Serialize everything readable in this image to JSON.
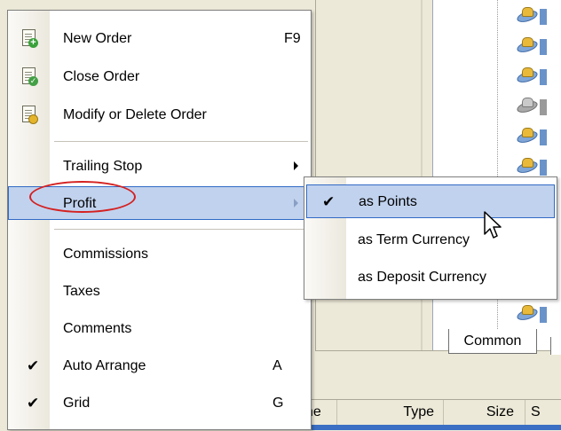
{
  "menu": {
    "items": [
      {
        "label": "New Order",
        "shortcut": "F9",
        "icon": "new-order-icon"
      },
      {
        "label": "Close Order",
        "icon": "close-order-icon"
      },
      {
        "label": "Modify or Delete Order",
        "icon": "modify-order-icon"
      },
      {
        "label": "Trailing Stop",
        "has_submenu": true
      },
      {
        "label": "Profit",
        "has_submenu": true,
        "highlighted": true,
        "circled": true
      },
      {
        "label": "Commissions"
      },
      {
        "label": "Taxes"
      },
      {
        "label": "Comments"
      },
      {
        "label": "Auto Arrange",
        "shortcut": "A",
        "checked": true
      },
      {
        "label": "Grid",
        "shortcut": "G",
        "checked": true
      }
    ],
    "check_glyph": "✔"
  },
  "submenu": {
    "items": [
      {
        "label": "as Points",
        "checked": true,
        "highlighted": true
      },
      {
        "label": "as Term Currency"
      },
      {
        "label": "as Deposit Currency"
      }
    ]
  },
  "background": {
    "tab_label": "Common",
    "column_headers": [
      "ime",
      "Type",
      "Size",
      "S"
    ]
  },
  "colors": {
    "highlight_bg": "#c1d2ee",
    "highlight_border": "#316ac5",
    "annotation_circle": "#d42121"
  }
}
